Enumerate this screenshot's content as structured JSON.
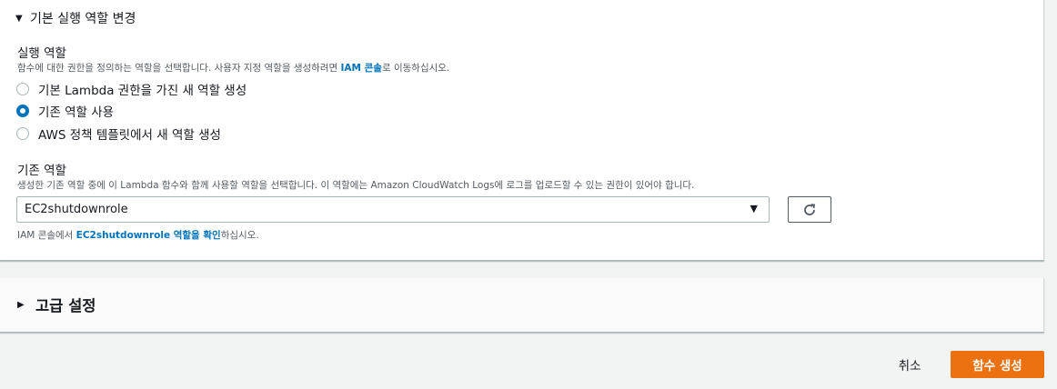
{
  "execution_section": {
    "toggle_label": "기본 실행 역할 변경",
    "role_label": "실행 역할",
    "role_desc_pre": "함수에 대한 권한을 정의하는 역할을 선택합니다. 사용자 지정 역할을 생성하려면 ",
    "role_desc_link": "IAM 콘솔",
    "role_desc_post": "로 이동하십시오.",
    "options": [
      {
        "label": "기본 Lambda 권한을 가진 새 역할 생성",
        "selected": false
      },
      {
        "label": "기존 역할 사용",
        "selected": true
      },
      {
        "label": "AWS 정책 템플릿에서 새 역할 생성",
        "selected": false
      }
    ],
    "existing_label": "기존 역할",
    "existing_desc": "생성한 기존 역할 중에 이 Lambda 함수와 함께 사용할 역할을 선택합니다. 이 역할에는 Amazon CloudWatch Logs에 로그를 업로드할 수 있는 권한이 있어야 합니다.",
    "selected_role": "EC2shutdownrole",
    "help_pre": "IAM 콘솔에서 ",
    "help_link": "EC2shutdownrole 역할을 확인",
    "help_post": "하십시오."
  },
  "advanced": {
    "title": "고급 설정"
  },
  "footer": {
    "cancel_label": "취소",
    "create_label": "함수 생성"
  },
  "icons": {
    "expanded": "caret-down-icon",
    "collapsed": "caret-right-icon",
    "dropdown": "dropdown-caret-icon",
    "refresh": "refresh-icon"
  },
  "colors": {
    "link": "#0073bb",
    "primary": "#ec7211",
    "radio_selected": "#0073bb"
  }
}
